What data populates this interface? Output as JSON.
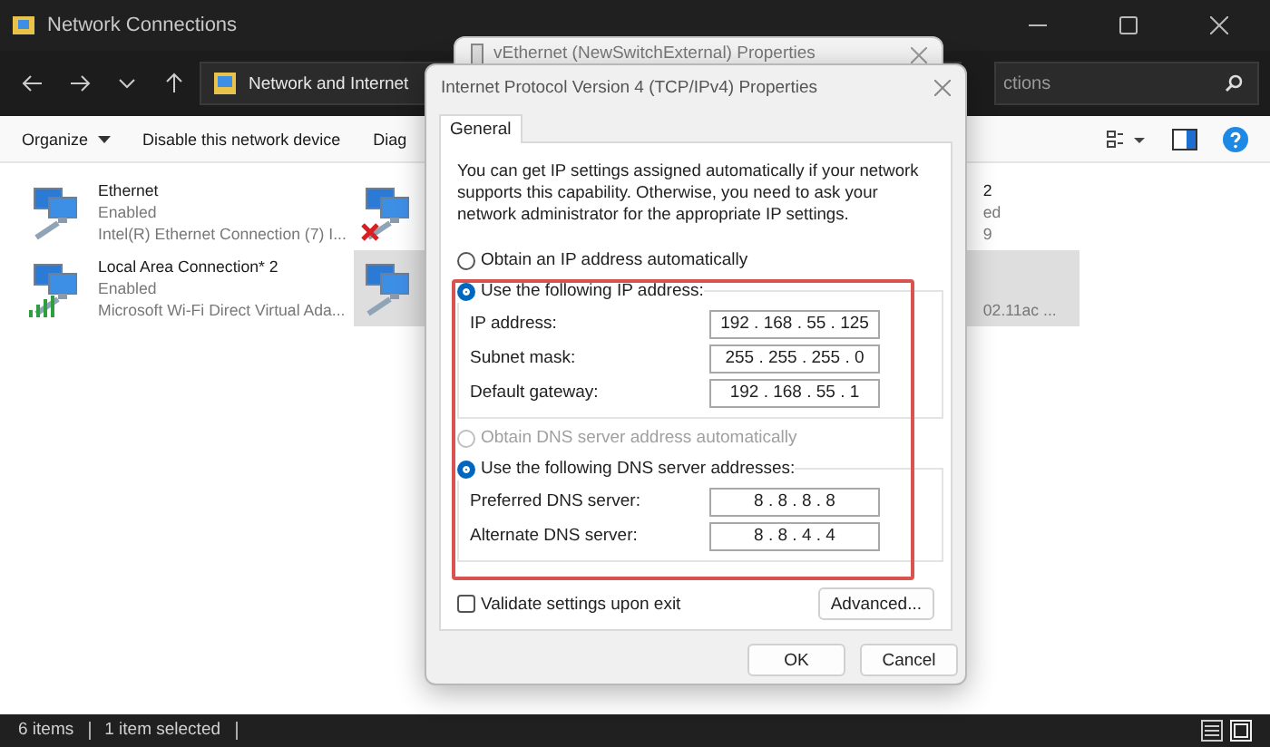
{
  "explorer": {
    "title": "Network Connections",
    "address": "Network and Internet",
    "search": {
      "placeholder": "ctions"
    },
    "toolbar": [
      {
        "label": "Organize",
        "kind": "menu"
      },
      {
        "label": "Disable this network device",
        "kind": "button"
      },
      {
        "label": "Diag",
        "kind": "button"
      }
    ],
    "connections": [
      {
        "name": "Ethernet",
        "status": "Enabled",
        "device": "Intel(R) Ethernet Connection (7) I...",
        "kind": "wired",
        "disconnected": false,
        "selected": false
      },
      {
        "name": "Local Area Connection* 2",
        "status": "Enabled",
        "device": "Microsoft Wi-Fi Direct Virtual Ada...",
        "kind": "wireless",
        "disconnected": false,
        "selected": false
      }
    ],
    "connections_column_2": [
      {
        "name": "2",
        "status": "ed",
        "device": "9",
        "disconnected": true,
        "selected": false
      },
      {
        "device": "02.11ac ...",
        "disconnected": false,
        "selected": true
      }
    ],
    "status_bar": {
      "count": "6 items",
      "selection": "1 item selected"
    }
  },
  "back_dialog": {
    "title": "vEthernet (NewSwitchExternal) Properties"
  },
  "dialog": {
    "title": "Internet Protocol Version 4 (TCP/IPv4) Properties",
    "tabs": [
      {
        "label": "General",
        "selected": true
      }
    ],
    "description": "You can get IP settings assigned automatically if your network supports this capability. Otherwise, you need to ask your network administrator for the appropriate IP settings.",
    "ip_options": [
      {
        "label": "Obtain an IP address automatically",
        "selected": false,
        "disabled": false
      },
      {
        "label": "Use the following IP address:",
        "selected": true,
        "disabled": false
      }
    ],
    "ip_fields": [
      {
        "label": "IP address:",
        "value": "192 . 168 . 55 . 125"
      },
      {
        "label": "Subnet mask:",
        "value": "255 . 255 . 255 . 0"
      },
      {
        "label": "Default gateway:",
        "value": "192 . 168 . 55 . 1"
      }
    ],
    "dns_options": [
      {
        "label": "Obtain DNS server address automatically",
        "selected": false,
        "disabled": true
      },
      {
        "label": "Use the following DNS server addresses:",
        "selected": true,
        "disabled": false
      }
    ],
    "dns_fields": [
      {
        "label": "Preferred DNS server:",
        "value": "8 . 8 . 8 . 8"
      },
      {
        "label": "Alternate DNS server:",
        "value": "8 . 8 . 4 . 4"
      }
    ],
    "validate": {
      "label": "Validate settings upon exit",
      "checked": false
    },
    "advanced": "Advanced...",
    "buttons": [
      "OK",
      "Cancel"
    ]
  }
}
